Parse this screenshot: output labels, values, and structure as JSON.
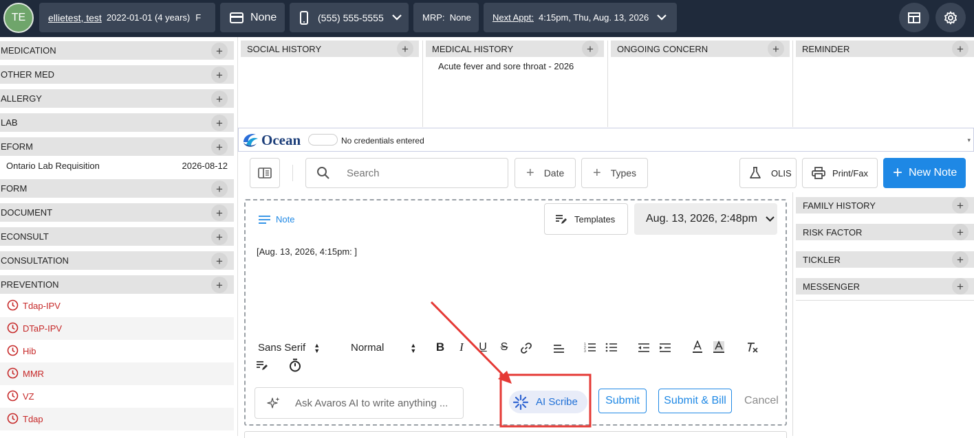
{
  "topbar": {
    "avatar_initials": "TE",
    "patient_name": "ellietest, test",
    "patient_dob_age": "2022-01-01 (4 years)",
    "patient_sex": "F",
    "insurance_label": "None",
    "phone": "(555) 555-5555",
    "mrp": "MRP:  None",
    "next_appt_label": "Next Appt:",
    "next_appt_value": "4:15pm, Thu, Aug. 13, 2026"
  },
  "left_sections": {
    "medication": "MEDICATION",
    "other_med": "OTHER MED",
    "allergy": "ALLERGY",
    "lab": "LAB",
    "eform": "EFORM",
    "eform_item_name": "Ontario Lab Requisition",
    "eform_item_date": "2026-08-12",
    "form": "FORM",
    "document": "DOCUMENT",
    "econsult": "ECONSULT",
    "consultation": "CONSULTATION",
    "prevention": "PREVENTION"
  },
  "prevention_items": [
    "Tdap-IPV",
    "DTaP-IPV",
    "Hib",
    "MMR",
    "VZ",
    "Tdap"
  ],
  "top_sections": {
    "social_history": "SOCIAL HISTORY",
    "medical_history": "MEDICAL HISTORY",
    "medical_history_item": "Acute fever and sore throat - 2026",
    "ongoing_concern": "ONGOING CONCERN",
    "reminder": "REMINDER"
  },
  "ocean": {
    "logo_text": "Ocean",
    "status": "No credentials entered"
  },
  "toolbar": {
    "search_placeholder": "Search",
    "date_label": "Date",
    "types_label": "Types",
    "olis_label": "OLIS",
    "print_fax_label": "Print/Fax",
    "new_note_label": "New Note"
  },
  "note": {
    "tab_label": "Note",
    "templates_label": "Templates",
    "datetime": "Aug. 13, 2026, 2:48pm",
    "body": "[Aug. 13, 2026, 4:15pm: ]",
    "font_family": "Sans Serif",
    "font_size": "Normal",
    "ai_prompt_placeholder": "Ask Avaros AI to write anything ...",
    "ai_scribe_label": "AI Scribe",
    "submit_label": "Submit",
    "submit_bill_label": "Submit & Bill",
    "cancel_label": "Cancel"
  },
  "right_sections": {
    "family_history": "FAMILY HISTORY",
    "risk_factor": "RISK FACTOR",
    "tickler": "TICKLER",
    "messenger": "MESSENGER"
  },
  "colors": {
    "topbar": "#1f2a3b",
    "accent_blue": "#1e88e5",
    "prevention_red": "#c62828",
    "annotation_red": "#e53935"
  }
}
